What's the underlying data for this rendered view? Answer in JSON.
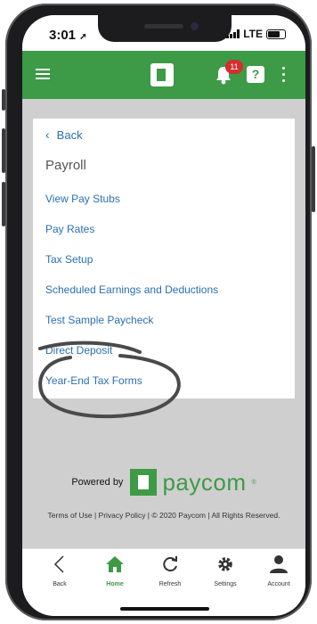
{
  "status_bar": {
    "time": "3:01",
    "network": "LTE"
  },
  "app_bar": {
    "notification_count": "11",
    "help_symbol": "?"
  },
  "page": {
    "back_label": "Back",
    "title": "Payroll",
    "links": [
      "View Pay Stubs",
      "Pay Rates",
      "Tax Setup",
      "Scheduled Earnings and Deductions",
      "Test Sample Paycheck",
      "Direct Deposit",
      "Year-End Tax Forms"
    ]
  },
  "footer": {
    "powered_by": "Powered by",
    "brand": "paycom",
    "brand_mark": "®",
    "legal": "Terms of Use | Privacy Policy | © 2020 Paycom | All Rights Reserved."
  },
  "tabs": [
    {
      "label": "Back",
      "icon": "chevron-left-icon"
    },
    {
      "label": "Home",
      "icon": "home-icon"
    },
    {
      "label": "Refresh",
      "icon": "refresh-icon"
    },
    {
      "label": "Settings",
      "icon": "gear-icon"
    },
    {
      "label": "Account",
      "icon": "person-icon"
    }
  ],
  "colors": {
    "brand_green": "#3d9a46",
    "link_blue": "#2b6fb3",
    "badge_red": "#d32f2f"
  }
}
